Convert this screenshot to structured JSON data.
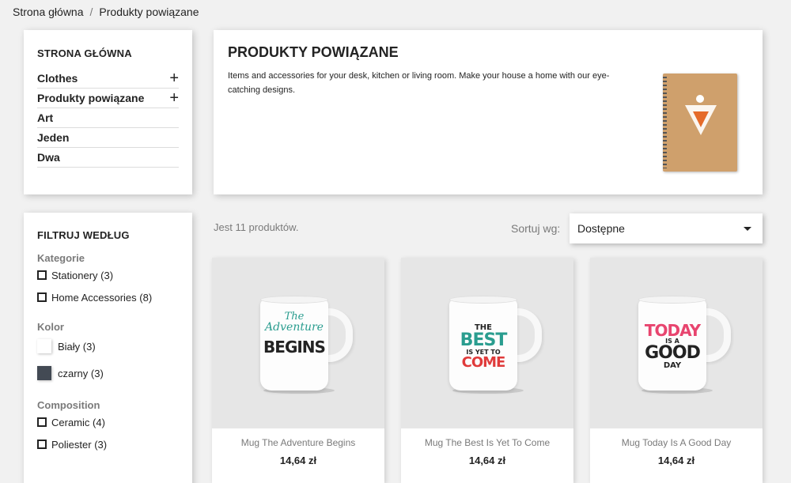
{
  "breadcrumb": {
    "home": "Strona główna",
    "separator": "/",
    "current": "Produkty powiązane"
  },
  "categories": {
    "title": "STRONA GŁÓWNA",
    "items": [
      {
        "label": "Clothes",
        "expand": "+"
      },
      {
        "label": "Produkty powiązane",
        "expand": "+"
      },
      {
        "label": "Art",
        "expand": ""
      },
      {
        "label": "Jeden",
        "expand": ""
      },
      {
        "label": "Dwa",
        "expand": ""
      }
    ]
  },
  "header": {
    "title": "PRODUKTY POWIĄZANE",
    "description": "Items and accessories for your desk, kitchen or living room. Make your house a home with our eye-catching designs."
  },
  "filters": {
    "title": "FILTRUJ WEDŁUG",
    "kategorie": {
      "title": "Kategorie",
      "options": [
        "Stationery (3)",
        "Home Accessories (8)"
      ]
    },
    "kolor": {
      "title": "Kolor",
      "options": [
        {
          "label": "Biały (3)",
          "color": "#ffffff"
        },
        {
          "label": "czarny (3)",
          "color": "#434a54"
        }
      ]
    },
    "composition": {
      "title": "Composition",
      "options": [
        "Ceramic (4)",
        "Poliester (3)"
      ]
    }
  },
  "listing": {
    "count_text": "Jest 11 produktów.",
    "sort_label": "Sortuj wg:",
    "sort_value": "Dostępne"
  },
  "products": [
    {
      "name": "Mug The Adventure Begins",
      "price": "14,64 zł",
      "print": [
        "The",
        "Adventure",
        "BEGINS"
      ]
    },
    {
      "name": "Mug The Best Is Yet To Come",
      "price": "14,64 zł",
      "print": [
        "THE",
        "BEST",
        "IS YET TO",
        "COME"
      ]
    },
    {
      "name": "Mug Today Is A Good Day",
      "price": "14,64 zł",
      "print": [
        "TODAY",
        "IS A",
        "GOOD",
        "DAY"
      ]
    }
  ]
}
